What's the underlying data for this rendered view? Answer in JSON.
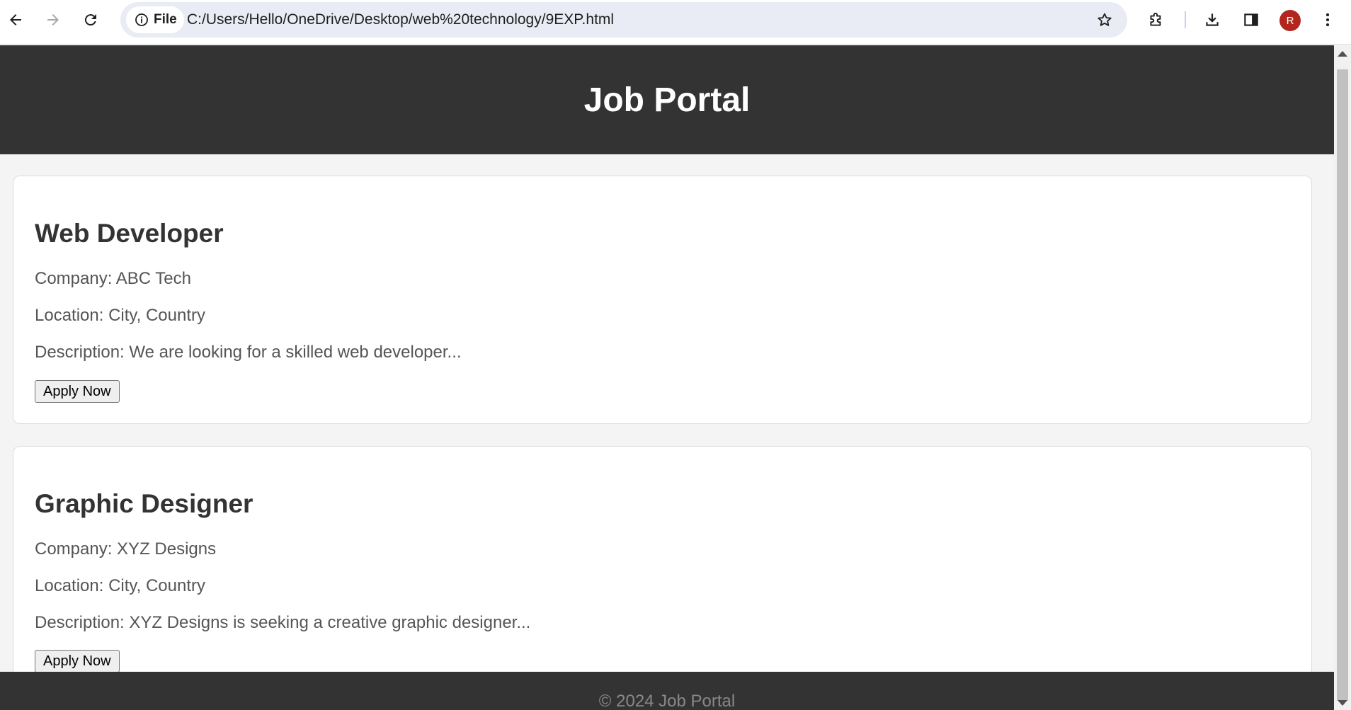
{
  "browser": {
    "back_icon": "arrow-left-icon",
    "forward_icon": "arrow-right-icon",
    "reload_icon": "reload-icon",
    "site_chip_label": "File",
    "url": "C:/Users/Hello/OneDrive/Desktop/web%20technology/9EXP.html",
    "avatar_letter": "R",
    "avatar_color": "#b3261e"
  },
  "page": {
    "title": "Job Portal",
    "jobs": [
      {
        "title": "Web Developer",
        "company": "Company: ABC Tech",
        "location": "Location: City, Country",
        "description": "Description: We are looking for a skilled web developer...",
        "apply_label": "Apply Now"
      },
      {
        "title": "Graphic Designer",
        "company": "Company: XYZ Designs",
        "location": "Location: City, Country",
        "description": "Description: XYZ Designs is seeking a creative graphic designer...",
        "apply_label": "Apply Now"
      }
    ],
    "footer": "© 2024 Job Portal"
  },
  "colors": {
    "header_bg": "#333333",
    "page_bg": "#f4f4f4",
    "card_bg": "#ffffff"
  }
}
